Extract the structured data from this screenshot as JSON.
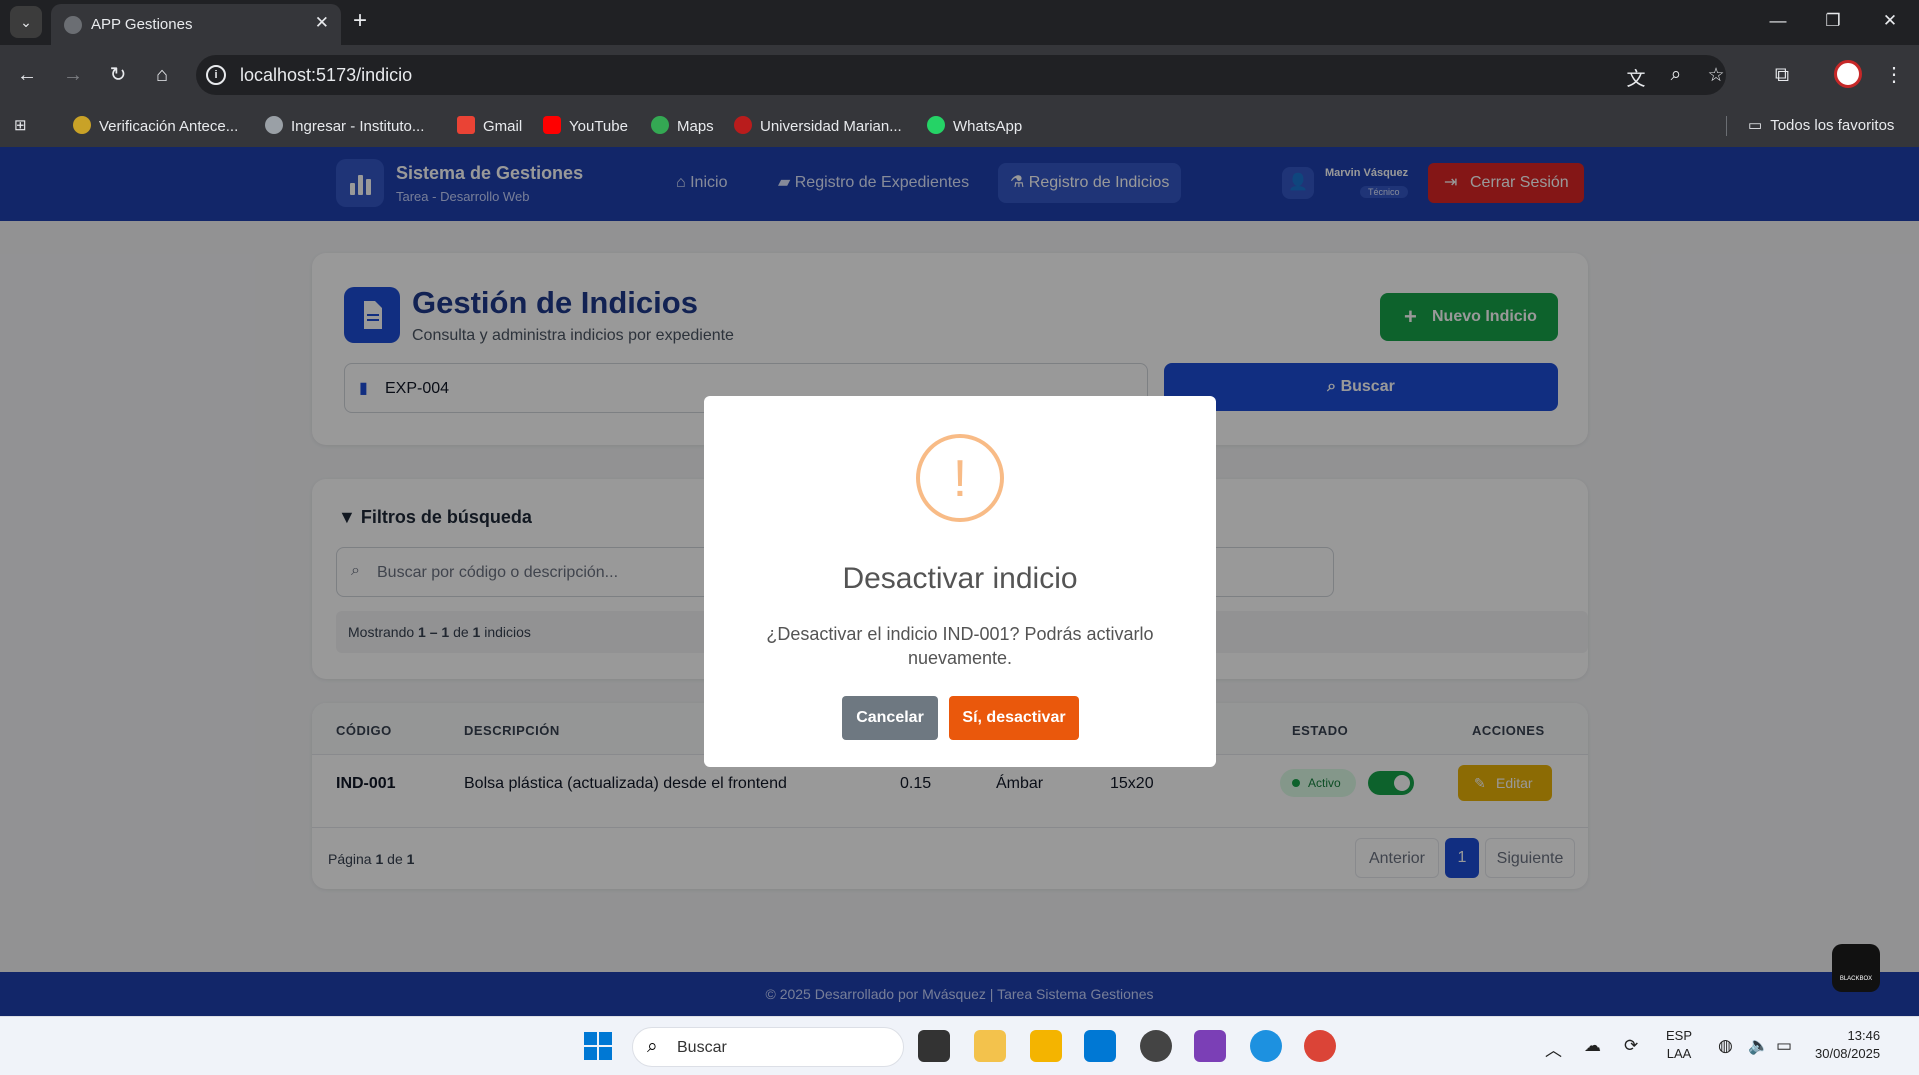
{
  "browser": {
    "tab_title": "APP Gestiones",
    "url": "localhost:5173/indicio",
    "bookmarks": [
      {
        "label": "Verificación Antece..."
      },
      {
        "label": "Ingresar - Instituto..."
      },
      {
        "label": "Gmail"
      },
      {
        "label": "YouTube"
      },
      {
        "label": "Maps"
      },
      {
        "label": "Universidad Marian..."
      },
      {
        "label": "WhatsApp"
      }
    ],
    "all_bookmarks": "Todos los favoritos"
  },
  "header": {
    "brand_title": "Sistema de Gestiones",
    "brand_subtitle": "Tarea - Desarrollo Web",
    "nav": [
      {
        "label": "Inicio",
        "icon": "home-icon"
      },
      {
        "label": "Registro de Expedientes",
        "icon": "folder-icon"
      },
      {
        "label": "Registro de Indicios",
        "icon": "flask-icon"
      }
    ],
    "user_name": "Marvin Vásquez",
    "user_role": "Técnico",
    "logout_label": "Cerrar Sesión"
  },
  "page": {
    "title": "Gestión de Indicios",
    "subtitle": "Consulta y administra indicios por expediente",
    "new_button": "Nuevo Indicio",
    "expediente_value": "EXP-004",
    "search_button": "Buscar"
  },
  "filters": {
    "title": "Filtros de búsqueda",
    "search_placeholder": "Buscar por código o descripción...",
    "showing_prefix": "Mostrando ",
    "showing_range": "1 – 1",
    "showing_mid": " de ",
    "showing_total": "1",
    "showing_suffix": " indicios"
  },
  "table": {
    "headers": [
      "CÓDIGO",
      "DESCRIPCIÓN",
      "ESTADO",
      "ACCIONES"
    ],
    "rows": [
      {
        "codigo": "IND-001",
        "descripcion": "Bolsa plástica (actualizada) desde el frontend",
        "peso": "0.15",
        "color": "Ámbar",
        "tamano": "15x20",
        "estado": "Activo",
        "accion": "Editar"
      }
    ],
    "page_prefix": "Página ",
    "page_current": "1",
    "page_mid": " de ",
    "page_total": "1",
    "prev_label": "Anterior",
    "page_number": "1",
    "next_label": "Siguiente"
  },
  "modal": {
    "icon": "!",
    "title": "Desactivar indicio",
    "text": "¿Desactivar el indicio IND-001? Podrás activarlo nuevamente.",
    "cancel": "Cancelar",
    "confirm": "Sí, desactivar"
  },
  "footer": {
    "text": "© 2025 Desarrollado por Mvásquez | Tarea Sistema Gestiones",
    "badge": "BLACKBOX"
  },
  "taskbar": {
    "search_placeholder": "Buscar",
    "lang_top": "ESP",
    "lang_bottom": "LAA",
    "time": "13:46",
    "date": "30/08/2025"
  },
  "colors": {
    "header_blue": "#1e40af",
    "primary_blue": "#1d4ed8",
    "success_green": "#16a34a",
    "danger_red": "#dc2626",
    "warning_yellow": "#eab308",
    "confirm_orange": "#ea580c",
    "cancel_gray": "#6e7881"
  }
}
